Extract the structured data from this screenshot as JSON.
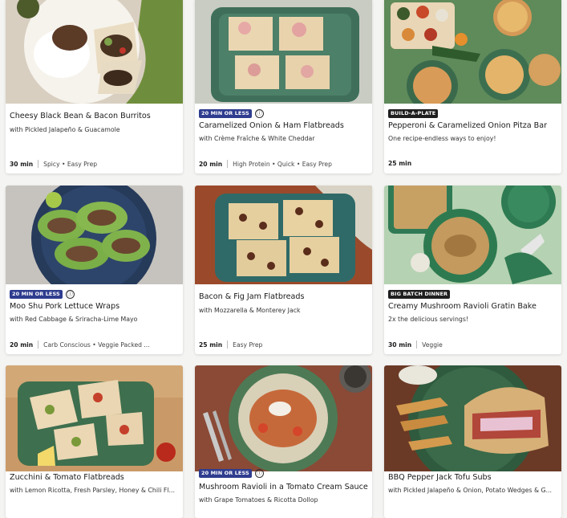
{
  "recipes": [
    {
      "title": "Cheesy Black Bean & Bacon Burritos",
      "subtitle": "with Pickled Jalapeño & Guacamole",
      "time": "30 min",
      "tags": "Spicy • Easy Prep",
      "badge": ""
    },
    {
      "title": "Caramelized Onion & Ham Flatbreads",
      "subtitle": "with Crème Fraîche & White Cheddar",
      "time": "20 min",
      "tags": "High Protein • Quick • Easy Prep",
      "badge": "20 MIN OR LESS"
    },
    {
      "title": "Pepperoni & Caramelized Onion Pitza Bar",
      "subtitle": "One recipe-endless ways to enjoy!",
      "time": "25 min",
      "tags": "",
      "badge": "BUILD-A-PLATE"
    },
    {
      "title": "Moo Shu Pork Lettuce Wraps",
      "subtitle": "with Red Cabbage & Sriracha-Lime Mayo",
      "time": "20 min",
      "tags": "Carb Conscious • Veggie Packed ...",
      "badge": "20 MIN OR LESS"
    },
    {
      "title": "Bacon & Fig Jam Flatbreads",
      "subtitle": "with Mozzarella & Monterey Jack",
      "time": "25 min",
      "tags": "Easy Prep",
      "badge": ""
    },
    {
      "title": "Creamy Mushroom Ravioli Gratin Bake",
      "subtitle": "2x the delicious servings!",
      "time": "30 min",
      "tags": "Veggie",
      "badge": "BIG BATCH DINNER"
    },
    {
      "title": "Zucchini & Tomato Flatbreads",
      "subtitle": "with Lemon Ricotta, Fresh Parsley, Honey & Chili Fl...",
      "time": "",
      "tags": "",
      "badge": ""
    },
    {
      "title": "Mushroom Ravioli in a Tomato Cream Sauce",
      "subtitle": "with Grape Tomatoes & Ricotta Dollop",
      "time": "",
      "tags": "",
      "badge": "20 MIN OR LESS"
    },
    {
      "title": "BBQ Pepper Jack Tofu Subs",
      "subtitle": "with Pickled Jalapeño & Onion, Potato Wedges & G...",
      "time": "",
      "tags": "",
      "badge": ""
    }
  ],
  "info_icon": "ⓘ",
  "colors": {
    "badge_blue": "#2f3d8f",
    "badge_dark": "#1f1f1f"
  }
}
